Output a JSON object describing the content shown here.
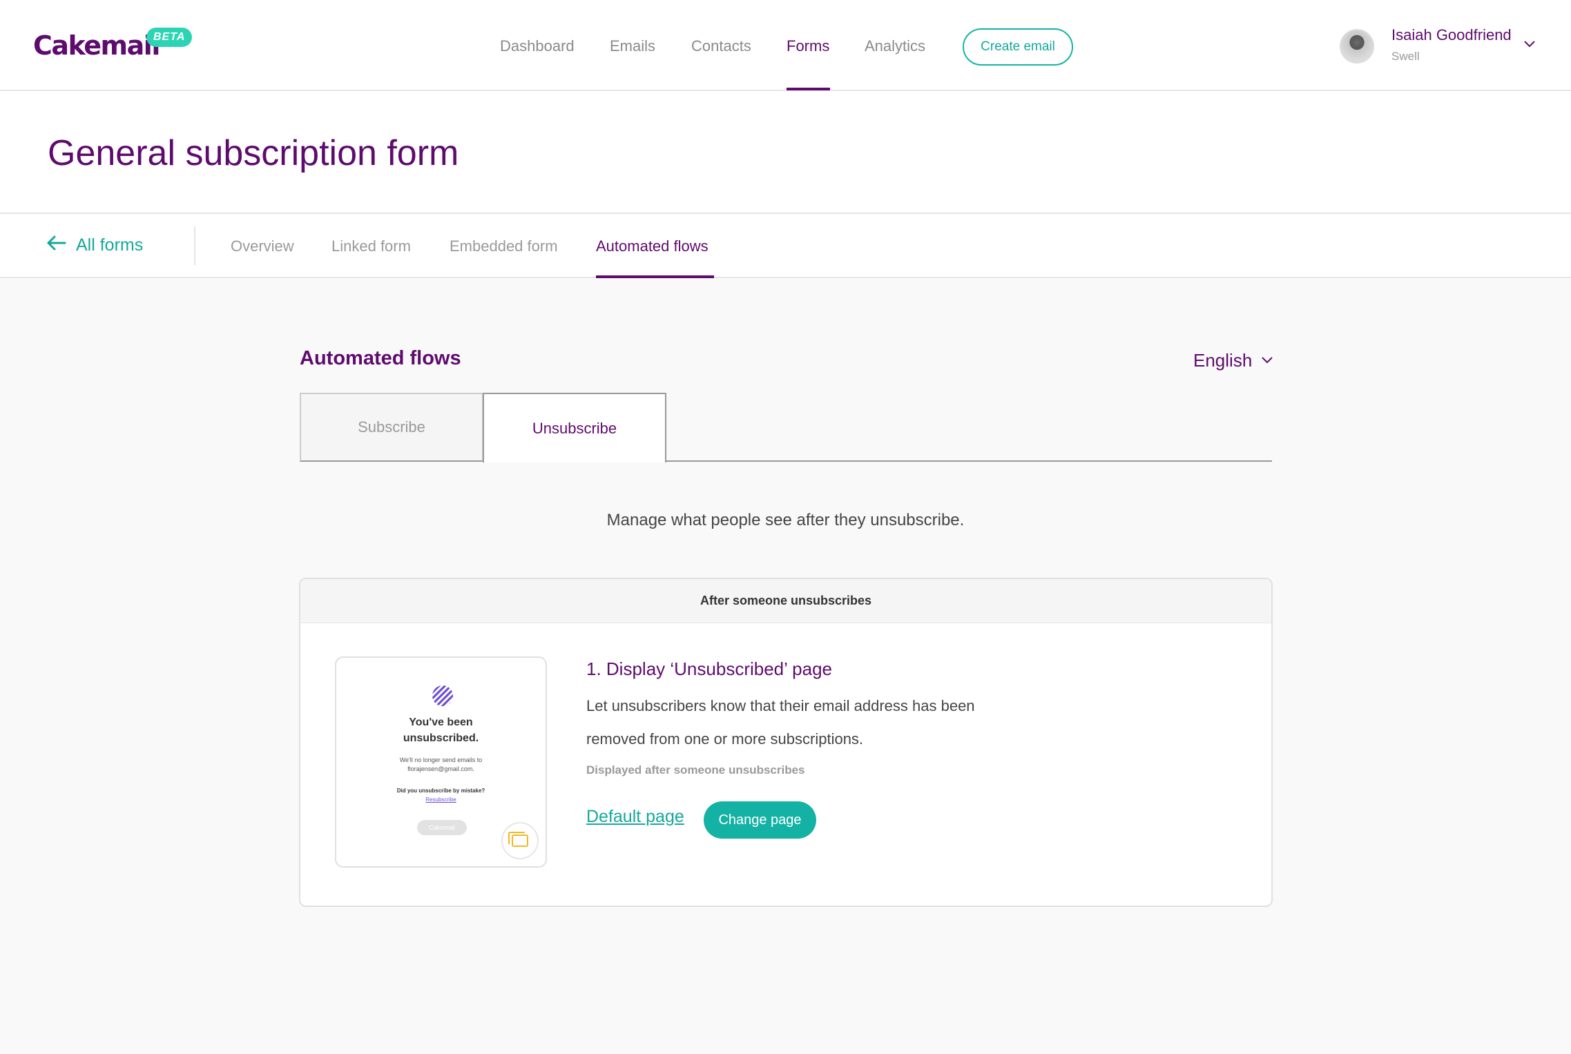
{
  "brand": {
    "logo_text": "Cakemail",
    "badge": "BETA"
  },
  "nav": {
    "items": [
      "Dashboard",
      "Emails",
      "Contacts",
      "Forms",
      "Analytics"
    ],
    "active": "Forms",
    "create_label": "Create email"
  },
  "user": {
    "name": "Isaiah Goodfriend",
    "org": "Swell"
  },
  "page": {
    "title": "General subscription form"
  },
  "subnav": {
    "back_label": "All forms",
    "items": [
      "Overview",
      "Linked form",
      "Embedded form",
      "Automated flows"
    ],
    "active": "Automated flows"
  },
  "section": {
    "title": "Automated flows",
    "language": "English",
    "tabs": [
      "Subscribe",
      "Unsubscribe"
    ],
    "active_tab": "Unsubscribe",
    "intro": "Manage what people see after they unsubscribe."
  },
  "card": {
    "header": "After someone unsubscribes",
    "preview": {
      "title_line1": "You've been",
      "title_line2": "unsubscribed.",
      "body_line1": "We'll no longer send emails to",
      "body_line2": "florajensen@gmail.com.",
      "question": "Did you unsubscribe by mistake?",
      "link": "Resubscribe",
      "footer": "Cakemail"
    },
    "step": {
      "title": "1. Display ‘Unsubscribed’ page",
      "desc_line1": "Let unsubscribers know that their email address has been",
      "desc_line2": "removed from one or more subscriptions.",
      "meta": "Displayed after someone unsubscribes",
      "default_link": "Default page",
      "change_button": "Change page"
    }
  },
  "colors": {
    "brand": "#5e0b6e",
    "accent": "#14b2a4",
    "badge": "#2dd4b4"
  },
  "icons": {
    "back": "arrow-left-icon",
    "chevron": "chevron-down-icon",
    "template": "template-icon"
  }
}
